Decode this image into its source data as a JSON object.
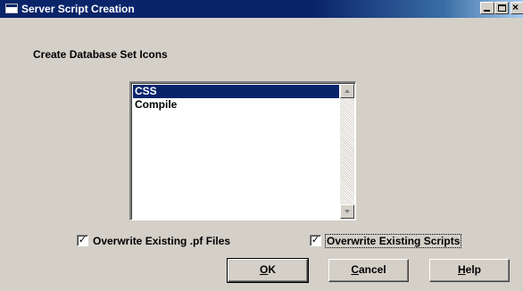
{
  "window": {
    "title": "Server Script Creation",
    "controls": {
      "minimize": "minimize-icon",
      "maximize": "maximize-icon",
      "close": "close-icon"
    }
  },
  "heading": "Create Database Set Icons",
  "list": {
    "items": [
      {
        "label": "CSS",
        "selected": true
      },
      {
        "label": "Compile",
        "selected": false
      }
    ]
  },
  "options": {
    "overwrite_pf": {
      "label": "Overwrite Existing .pf Files",
      "checked": true
    },
    "overwrite_scripts": {
      "label": "Overwrite Existing Scripts",
      "checked": true
    }
  },
  "buttons": {
    "ok": {
      "mnemonic": "O",
      "rest": "K"
    },
    "cancel": {
      "mnemonic": "C",
      "rest": "ancel"
    },
    "help": {
      "mnemonic": "H",
      "rest": "elp"
    }
  },
  "glyphs": {
    "check": "✓"
  },
  "colors": {
    "title_bar": "#0a246a",
    "selection": "#0a246a",
    "face": "#d4d0c8"
  }
}
